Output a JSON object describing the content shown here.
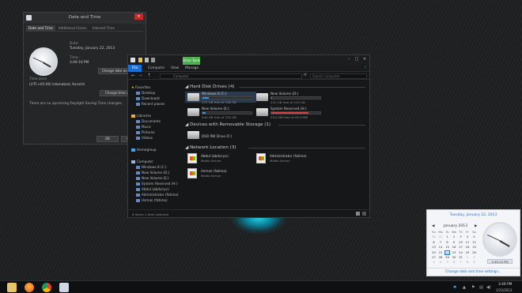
{
  "datetime_dialog": {
    "title": "Date and Time",
    "tabs": [
      "Date and Time",
      "Additional Clocks",
      "Internet Time"
    ],
    "date_label": "Date:",
    "date_value": "Tuesday, January 22, 2013",
    "time_label": "Time:",
    "time_value": "3:49:10 PM",
    "change_btn": "Change date and time...",
    "timezone_label": "Time zone",
    "timezone_value": "(UTC+05:00) Islamabad, Karachi",
    "change_tz_btn": "Change time zone...",
    "dst_note": "There are no upcoming Daylight Saving Time changes.",
    "ok": "OK",
    "cancel": "Cancel"
  },
  "explorer": {
    "context_tab": "Drive Tools",
    "menu": [
      "File",
      "Computer",
      "View",
      "Manage"
    ],
    "address": "Computer",
    "search_placeholder": "Search Computer",
    "nav": {
      "favorites": "Favorites",
      "fav_items": [
        "Desktop",
        "Downloads",
        "Recent places"
      ],
      "libraries": "Libraries",
      "lib_items": [
        "Documents",
        "Music",
        "Pictures",
        "Videos"
      ],
      "homegroup": "Homegroup",
      "computer": "Computer",
      "comp_items": [
        "Windows 8 (C:)",
        "New Volume (D:)",
        "New Volume (E:)",
        "System Reserved (H:)",
        "Abdul (abdul-pc)",
        "Administrator (fatima)",
        "Usman (fatima)"
      ]
    },
    "sections": {
      "hdd": "Hard Disk Drives (4)",
      "removable": "Devices with Removable Storage (1)",
      "network": "Network Location (3)"
    },
    "drives": [
      {
        "name": "Windows 8 (C:)",
        "free": "172 GB free of 198 GB",
        "used_fraction": 0.13
      },
      {
        "name": "New Volume (D:)",
        "free": "222 GB free of 224 GB",
        "used_fraction": 0.01
      },
      {
        "name": "New Volume (E:)",
        "free": "209 GB free of 224 GB",
        "used_fraction": 0.07
      },
      {
        "name": "System Reserved (H:)",
        "free": "25.0 MB free of 99.9 MB",
        "used_fraction": 0.75
      }
    ],
    "removable": [
      {
        "name": "DVD RW Drive (F:)"
      }
    ],
    "network": [
      {
        "name": "Abdul (abdul-pc)",
        "sub": "Media Server"
      },
      {
        "name": "Administrator (fatima)",
        "sub": "Media Server"
      },
      {
        "name": "Usman (fatima)",
        "sub": "Media Server"
      }
    ],
    "status": "8 items    1 item selected"
  },
  "calendar": {
    "date_link": "Tuesday, January 22, 2013",
    "month": "January 2013",
    "weekdays": [
      "Su",
      "Mo",
      "Tu",
      "We",
      "Th",
      "Fr",
      "Sa"
    ],
    "rows": [
      [
        "30",
        "31",
        "1",
        "2",
        "3",
        "4",
        "5"
      ],
      [
        "6",
        "7",
        "8",
        "9",
        "10",
        "11",
        "12"
      ],
      [
        "13",
        "14",
        "15",
        "16",
        "17",
        "18",
        "19"
      ],
      [
        "20",
        "21",
        "22",
        "23",
        "24",
        "25",
        "26"
      ],
      [
        "27",
        "28",
        "29",
        "30",
        "31",
        "1",
        "2"
      ],
      [
        "3",
        "4",
        "5",
        "6",
        "7",
        "8",
        "9"
      ]
    ],
    "clock_text": "3:49:10 PM",
    "change_link": "Change date and time settings..."
  },
  "taskbar": {
    "time": "3:49 PM",
    "date": "1/22/2013"
  }
}
